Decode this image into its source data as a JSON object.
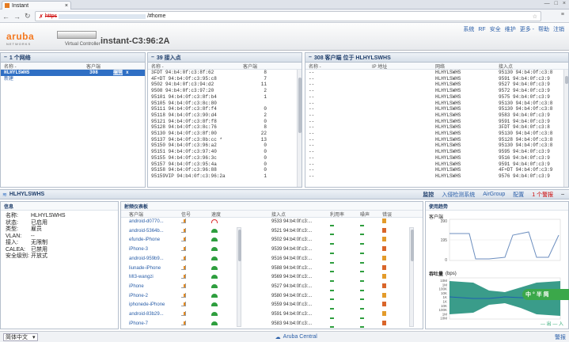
{
  "browser": {
    "tab_title": "Instant",
    "url_scheme": "https",
    "url_tail": "/#home"
  },
  "header": {
    "brand": "aruba",
    "brand_sub": "NETWORKS",
    "device_sub": "Virtual Controller",
    "title": "instant-C3:96:2A",
    "links": [
      "系统",
      "RF",
      "安全",
      "维护",
      "更多 -",
      "帮助",
      "注销"
    ]
  },
  "networks": {
    "title": "1 个网络",
    "cols": [
      "名称 -",
      "客户端"
    ],
    "rows": [
      {
        "name": "HLHYLSWHS",
        "clients": "308",
        "edit": "编辑",
        "del": "x"
      }
    ],
    "new": "新建"
  },
  "aps": {
    "title": "39 接入点",
    "cols": [
      "名称 -",
      "客户端"
    ],
    "rows": [
      [
        "3FDT 94:b4:0f:c3:8f:62",
        "8"
      ],
      [
        "4F+DT 94:b4:0f:c3:95:c8",
        "7"
      ],
      [
        "9502 94:b4:0f:c3:94:d2",
        "11"
      ],
      [
        "9508 94:b4:0f:c3:97:20",
        "2"
      ],
      [
        "95101 94:b4:0f:c3:8f:b4",
        "1"
      ],
      [
        "95105 94:b4:0f:c3:8c:80",
        ""
      ],
      [
        "95111 94:b4:0f:c3:8f:f4",
        "0"
      ],
      [
        "95118 94:b4:0f:c3:90:d4",
        "2"
      ],
      [
        "95121 94:b4:0f:c3:8f:f8",
        "0"
      ],
      [
        "95128 94:b4:0f:c3:8c:76",
        "8"
      ],
      [
        "95130 94:b4:0f:c3:8f:00",
        "22"
      ],
      [
        "95137 94:b4:0f:c3:8b:cc *",
        "13"
      ],
      [
        "95150 94:b4:0f:c3:96:a2",
        "0"
      ],
      [
        "95151 94:b4:0f:c3:97:40",
        "0"
      ],
      [
        "95155 94:b4:0f:c3:96:3c",
        "0"
      ],
      [
        "95157 94:b4:0f:c3:95:4a",
        "0"
      ],
      [
        "95158 94:b4:0f:c3:96:88",
        "0"
      ],
      [
        "95159VIP 94:b4:0f:c3:96:2a",
        "1"
      ]
    ]
  },
  "clients": {
    "title": "308 客户端 位于 HLHYLSWHS",
    "cols": [
      "名称 -",
      "IP 地址",
      "网络",
      "接入点"
    ],
    "rows": [
      [
        "--",
        "HLHYLSWHS",
        "95130 94:b4:0f:c3:8"
      ],
      [
        "--",
        "HLHYLSWHS",
        "9591 94:b4:0f:c3:9"
      ],
      [
        "--",
        "HLHYLSWHS",
        "9527 94:b4:0f:c3:9"
      ],
      [
        "--",
        "HLHYLSWHS",
        "9572 94:b4:0f:c3:9"
      ],
      [
        "--",
        "HLHYLSWHS",
        "9575 94:b4:0f:c3:9"
      ],
      [
        "--",
        "HLHYLSWHS",
        "95130 94:b4:0f:c3:8"
      ],
      [
        "--",
        "HLHYLSWHS",
        "95130 94:b4:0f:c3:8"
      ],
      [
        "--",
        "HLHYLSWHS",
        "9583 94:b4:0f:c3:9"
      ],
      [
        "--",
        "HLHYLSWHS",
        "9591 94:b4:0f:c3:9"
      ],
      [
        "--",
        "HLHYLSWHS",
        "3FDT 94:b4:0f:c3:8"
      ],
      [
        "--",
        "HLHYLSWHS",
        "95130 94:b4:0f:c3:8"
      ],
      [
        "--",
        "HLHYLSWHS",
        "95128 94:b4:0f:c3:8"
      ],
      [
        "--",
        "HLHYLSWHS",
        "95130 94:b4:0f:c3:8"
      ],
      [
        "--",
        "HLHYLSWHS",
        "9595 94:b4:0f:c3:9"
      ],
      [
        "--",
        "HLHYLSWHS",
        "9516 94:b4:0f:c3:9"
      ],
      [
        "--",
        "HLHYLSWHS",
        "9591 94:b4:0f:c3:9"
      ],
      [
        "--",
        "HLHYLSWHS",
        "4F+DT 94:b4:0f:c3:9"
      ],
      [
        "--",
        "HLHYLSWHS",
        "9576 94:b4:0f:c3:9"
      ]
    ]
  },
  "network_bar": {
    "title": "HLHYLSWHS",
    "tabs": [
      "监控",
      "入侵检测系统",
      "AirGroup",
      "配置"
    ],
    "alert": "1 个警报"
  },
  "info": {
    "title": "信息",
    "rows": [
      [
        "名称:",
        "HLHYLSWHS"
      ],
      [
        "状态:",
        "已启用"
      ],
      [
        "类型:",
        "雇员"
      ],
      [
        "VLAN:",
        "--"
      ],
      [
        "接入:",
        "无限制"
      ],
      [
        "CALEA:",
        "已禁用"
      ],
      [
        "安全级别:",
        "开放式"
      ]
    ]
  },
  "radio": {
    "title": "射频仪表板",
    "cols": [
      "客户端",
      "信号",
      "速度",
      "接入点",
      "利用率",
      "噪声",
      "错误"
    ],
    "rows": [
      [
        "android-d0770...",
        "9533 94:b4:0f:c3:..."
      ],
      [
        "android-5364b...",
        "9521 94:b4:0f:c3:..."
      ],
      [
        "efunde-iPhone",
        "9502 94:b4:0f:c3:..."
      ],
      [
        "iPhone-3",
        "9539 94:b4:0f:c3:..."
      ],
      [
        "android-959b9...",
        "9516 94:b4:0f:c3:..."
      ],
      [
        "liunade-iPhone",
        "9588 94:b4:0f:c3:..."
      ],
      [
        "MI3-wangzi",
        "9569 94:b4:0f:c3:..."
      ],
      [
        "iPhone",
        "9527 94:b4:0f:c3:..."
      ],
      [
        "iPhone-2",
        "9580 94:b4:0f:c3:..."
      ],
      [
        "iphonede-iPhone",
        "9559 94:b4:0f:c3:..."
      ],
      [
        "android-83b29...",
        "9591 94:b4:0f:c3:..."
      ],
      [
        "iPhone-7",
        "9583 94:b4:0f:c3:..."
      ]
    ]
  },
  "trends": {
    "title": "使用趋势",
    "clients_label": "客户端",
    "ticks": [
      "390",
      "195",
      "0"
    ],
    "throughput_label": "吞吐量",
    "throughput_unit": "(bps)",
    "tp_ticks": [
      "10M",
      "1M",
      "100K",
      "10K",
      "1K",
      "1K",
      "10K",
      "100K",
      "1M",
      "10M"
    ],
    "legend": "— 出 — 入",
    "overlay": "中 ° 半 简 "
  },
  "footer": {
    "lang": "简体中文",
    "center": "Aruba Central",
    "alert": "警报"
  }
}
